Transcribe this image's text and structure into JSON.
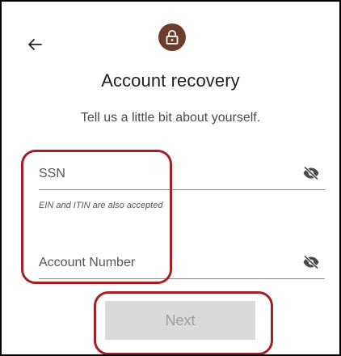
{
  "header": {
    "back_icon": "arrow-left-icon",
    "lock_icon": "lock-icon",
    "title": "Account recovery",
    "subtitle": "Tell us a little bit about yourself."
  },
  "form": {
    "ssn": {
      "placeholder": "SSN",
      "value": "",
      "visibility_icon": "eye-off-icon",
      "helper_text": "EIN and ITIN are also accepted"
    },
    "account_number": {
      "placeholder": "Account Number",
      "value": "",
      "visibility_icon": "eye-off-icon"
    },
    "next_label": "Next",
    "next_enabled": false
  },
  "colors": {
    "brand_badge": "#6b3d2c",
    "highlight": "#a32025",
    "disabled_button_bg": "#d9d9d9",
    "disabled_button_text": "#9e9e9e",
    "frame_border": "#000000"
  }
}
